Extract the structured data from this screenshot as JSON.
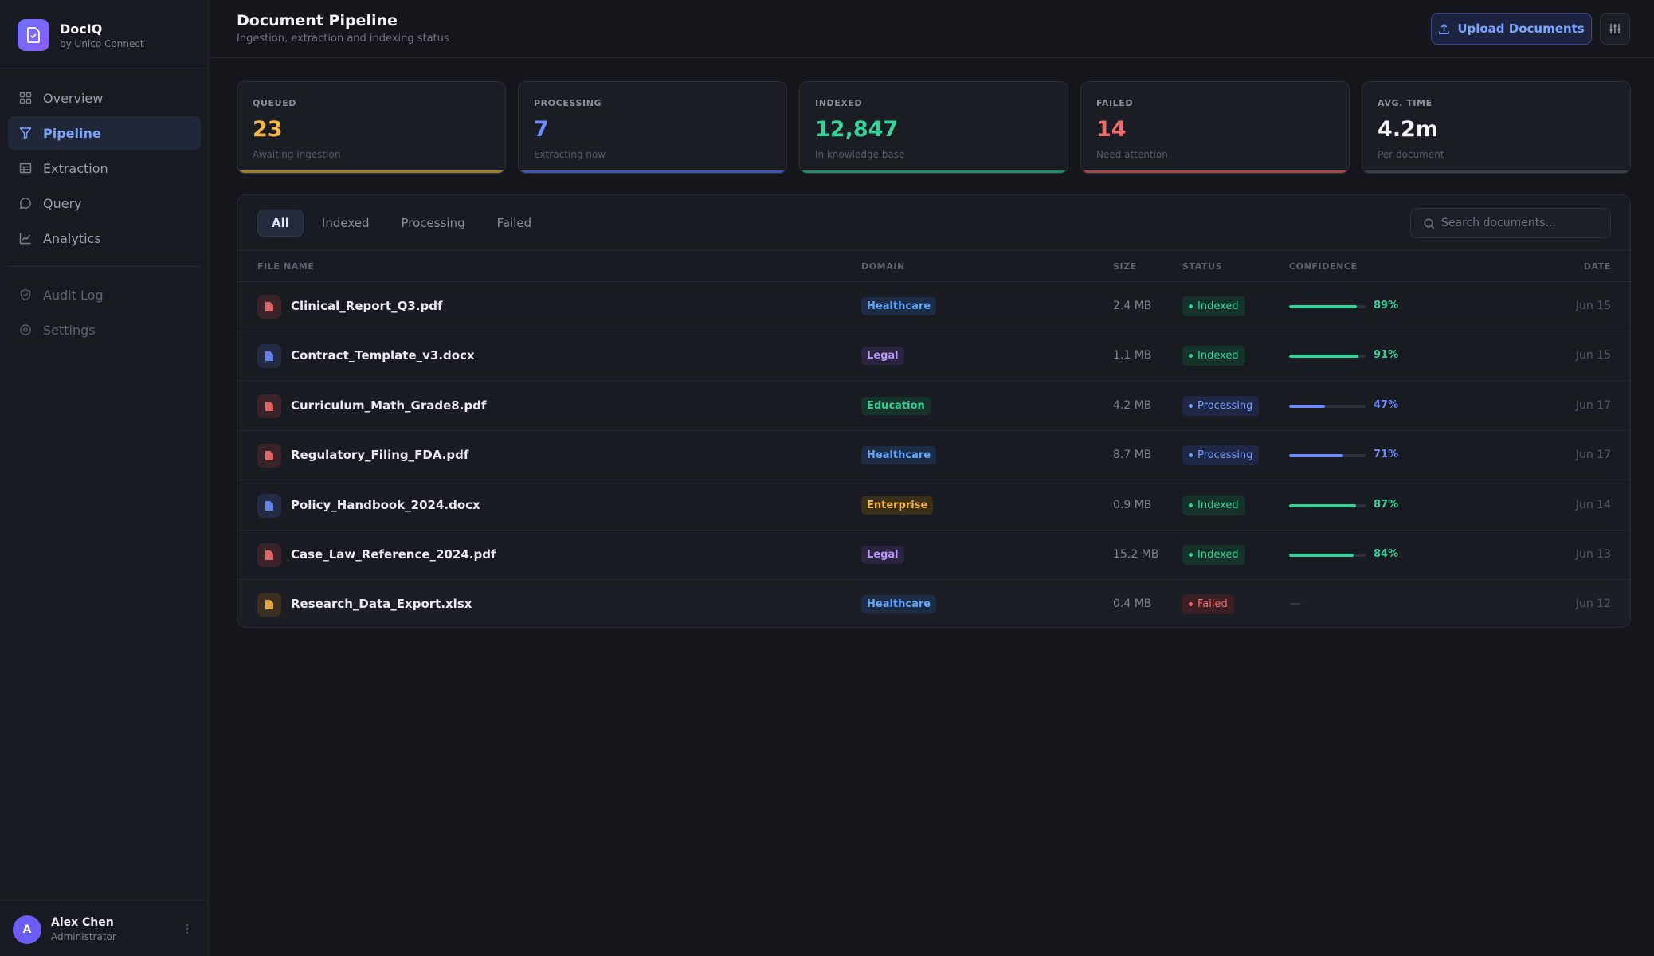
{
  "brand": {
    "name": "DocIQ",
    "subtitle": "by Unico Connect"
  },
  "sidebar": {
    "items": [
      {
        "label": "Overview",
        "icon": "grid-icon"
      },
      {
        "label": "Pipeline",
        "icon": "funnel-icon",
        "active": true
      },
      {
        "label": "Extraction",
        "icon": "table-icon"
      },
      {
        "label": "Query",
        "icon": "chat-icon"
      },
      {
        "label": "Analytics",
        "icon": "chart-line-icon"
      }
    ],
    "secondary_items": [
      {
        "label": "Audit Log",
        "icon": "shield-check-icon"
      },
      {
        "label": "Settings",
        "icon": "gear-icon"
      }
    ]
  },
  "user": {
    "initial": "A",
    "name": "Alex Chen",
    "role": "Administrator"
  },
  "header": {
    "title": "Document Pipeline",
    "subtitle": "Ingestion, extraction and indexing status",
    "upload_label": "Upload Documents"
  },
  "stats": [
    {
      "label": "QUEUED",
      "value": "23",
      "sub": "Awaiting ingestion",
      "color": "#f5b740"
    },
    {
      "label": "PROCESSING",
      "value": "7",
      "sub": "Extracting now",
      "color": "#6b8bff"
    },
    {
      "label": "INDEXED",
      "value": "12,847",
      "sub": "In knowledge base",
      "color": "#34d399"
    },
    {
      "label": "FAILED",
      "value": "14",
      "sub": "Need attention",
      "color": "#f26b6b"
    },
    {
      "label": "AVG. TIME",
      "value": "4.2m",
      "sub": "Per document",
      "color": "#f3f4f8"
    }
  ],
  "tabs": [
    "All",
    "Indexed",
    "Processing",
    "Failed"
  ],
  "search": {
    "placeholder": "Search documents..."
  },
  "table": {
    "headers": {
      "file": "FILE NAME",
      "domain": "DOMAIN",
      "size": "SIZE",
      "status": "STATUS",
      "confidence": "CONFIDENCE",
      "date": "DATE"
    },
    "rows": [
      {
        "file": "Clinical_Report_Q3.pdf",
        "type": "pdf",
        "domain": "Healthcare",
        "size": "2.4 MB",
        "status": "Indexed",
        "confidence": 89,
        "confidence_label": "89%",
        "date": "Jun 15"
      },
      {
        "file": "Contract_Template_v3.docx",
        "type": "docx",
        "domain": "Legal",
        "size": "1.1 MB",
        "status": "Indexed",
        "confidence": 91,
        "confidence_label": "91%",
        "date": "Jun 15"
      },
      {
        "file": "Curriculum_Math_Grade8.pdf",
        "type": "pdf",
        "domain": "Education",
        "size": "4.2 MB",
        "status": "Processing",
        "confidence": 47,
        "confidence_label": "47%",
        "date": "Jun 17"
      },
      {
        "file": "Regulatory_Filing_FDA.pdf",
        "type": "pdf",
        "domain": "Healthcare",
        "size": "8.7 MB",
        "status": "Processing",
        "confidence": 71,
        "confidence_label": "71%",
        "date": "Jun 17"
      },
      {
        "file": "Policy_Handbook_2024.docx",
        "type": "docx",
        "domain": "Enterprise",
        "size": "0.9 MB",
        "status": "Indexed",
        "confidence": 87,
        "confidence_label": "87%",
        "date": "Jun 14"
      },
      {
        "file": "Case_Law_Reference_2024.pdf",
        "type": "pdf",
        "domain": "Legal",
        "size": "15.2 MB",
        "status": "Indexed",
        "confidence": 84,
        "confidence_label": "84%",
        "date": "Jun 13"
      },
      {
        "file": "Research_Data_Export.xlsx",
        "type": "xlsx",
        "domain": "Healthcare",
        "size": "0.4 MB",
        "status": "Failed",
        "confidence": null,
        "confidence_label": "—",
        "date": "Jun 12"
      }
    ]
  },
  "colors": {
    "accent": "#7aa2ff",
    "indexed": "#34d399",
    "processing": "#6b8bff",
    "failed": "#f26b6b",
    "healthcare": "#60a5fa",
    "legal": "#b794f6",
    "education": "#34d399",
    "enterprise": "#f5b740"
  }
}
